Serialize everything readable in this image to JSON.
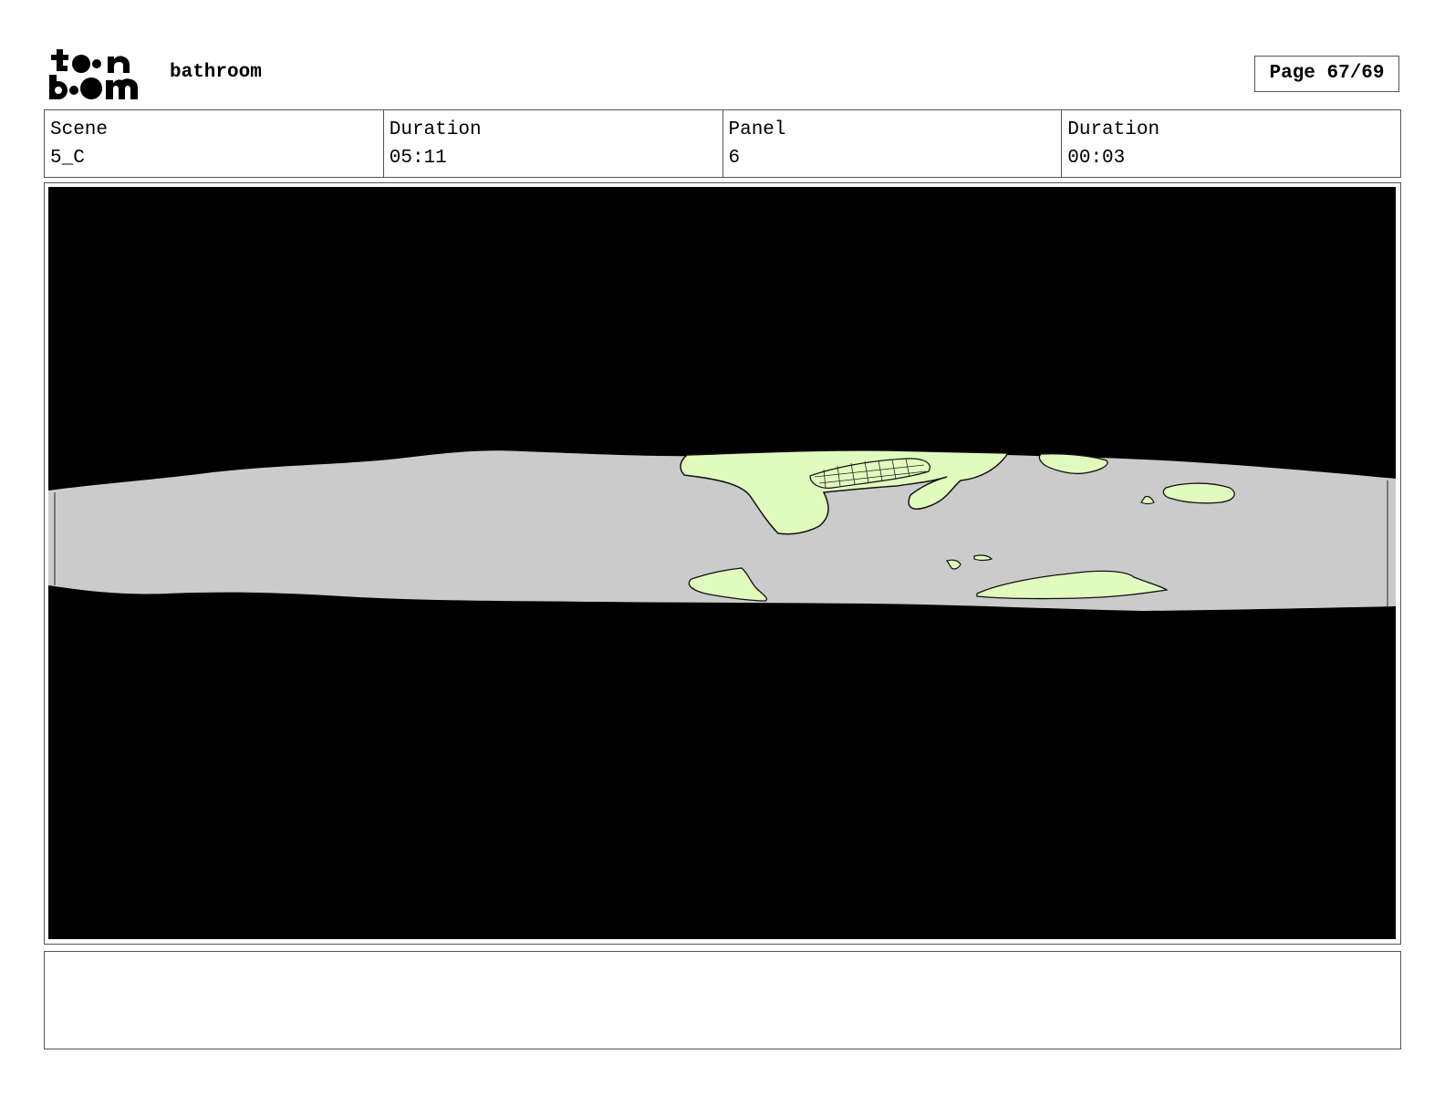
{
  "header": {
    "logo_text": "toon boom",
    "title": "bathroom",
    "page_label": "Page 67/69"
  },
  "info": [
    {
      "label": "Scene",
      "value": "5_C"
    },
    {
      "label": "Duration",
      "value": "05:11"
    },
    {
      "label": "Panel",
      "value": "6"
    },
    {
      "label": "Duration",
      "value": "00:03"
    }
  ],
  "panel": {
    "background_color": "#000000",
    "band_color": "#cbcbcb",
    "shape_color": "#e1fbbe"
  },
  "notes": {
    "text": ""
  }
}
